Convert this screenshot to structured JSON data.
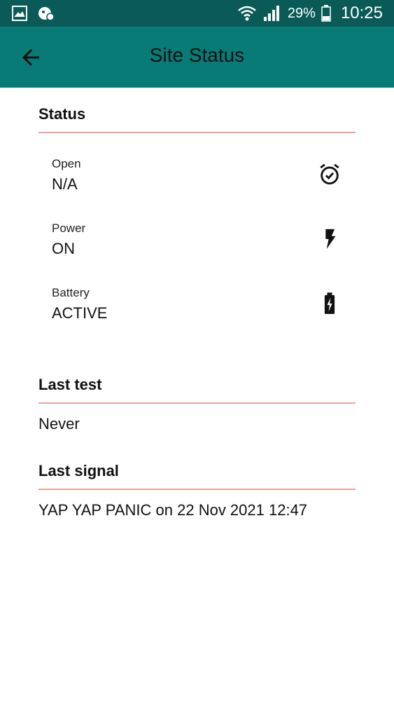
{
  "statusbar": {
    "battery_percent": "29%",
    "time": "10:25",
    "left_icons": [
      "gallery-icon",
      "notification-icon"
    ],
    "right_icons": [
      "wifi-icon",
      "signal-icon",
      "battery-icon"
    ]
  },
  "appbar": {
    "title": "Site Status",
    "back_icon": "arrow-left-icon",
    "background": "#087b76"
  },
  "status": {
    "heading": "Status",
    "items": [
      {
        "label": "Open",
        "value": "N/A",
        "icon": "alarm-clock-check-icon"
      },
      {
        "label": "Power",
        "value": "ON",
        "icon": "lightning-bolt-icon"
      },
      {
        "label": "Battery",
        "value": "ACTIVE",
        "icon": "battery-charging-icon"
      }
    ]
  },
  "last_test": {
    "heading": "Last test",
    "value": "Never"
  },
  "last_signal": {
    "heading": "Last signal",
    "value": "YAP YAP PANIC on 22 Nov 2021 12:47"
  },
  "colors": {
    "statusbar": "#0a5a57",
    "appbar": "#087b76",
    "divider": "#e8a49a"
  }
}
